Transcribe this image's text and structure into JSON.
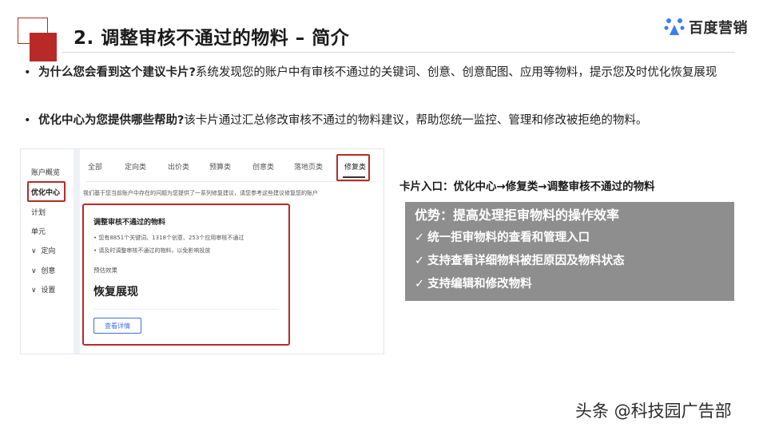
{
  "header": {
    "title": "2. 调整审核不通过的物料 – 简介",
    "logo_text": "百度营销",
    "accent_color": "#b82a27"
  },
  "bullets": [
    {
      "dot": "•",
      "bold": "为什么您会看到这个建议卡片?",
      "text": "系统发现您的账户中有审核不通过的关键词、创意、创意配图、应用等物料，提示您及时优化恢复展现"
    },
    {
      "dot": "•",
      "bold": "优化中心为您提供哪些帮助?",
      "text": "该卡片通过汇总修改审核不通过的物料建议，帮助您统一监控、管理和修改被拒绝的物料。"
    }
  ],
  "screenshot": {
    "sidebar": [
      "账户概览",
      "优化中心",
      "计划",
      "单元",
      "定向",
      "创意",
      "设置"
    ],
    "sidebar_prefix": "∨",
    "tabs": [
      "全部",
      "定向类",
      "出价类",
      "预算类",
      "创意类",
      "落地页类",
      "修复类"
    ],
    "description": "我们基于您当前账户中存在的问题为您提供了一系列修复建议，请您参考这些建议修复您的账户",
    "card": {
      "title": "调整审核不通过的物料",
      "line1": "• 您有8851个关键词、1318个创意、253个应用审核不通过",
      "line2": "• 请及时调整审核不通过的物料，以免影响投放",
      "effect_label": "预估效果",
      "effect_value": "恢复展现",
      "button": "查看详情"
    }
  },
  "entry": {
    "text": "卡片入口：优化中心→修复类→调整审核不通过的物料"
  },
  "advantages": {
    "title": "优势：提高处理拒审物料的操作效率",
    "check": "✓",
    "items": [
      "统一拒审物料的查看和管理入口",
      "支持查看详细物料被拒原因及物料状态",
      "支持编辑和修改物料"
    ]
  },
  "watermark": "头条 @科技园广告部"
}
